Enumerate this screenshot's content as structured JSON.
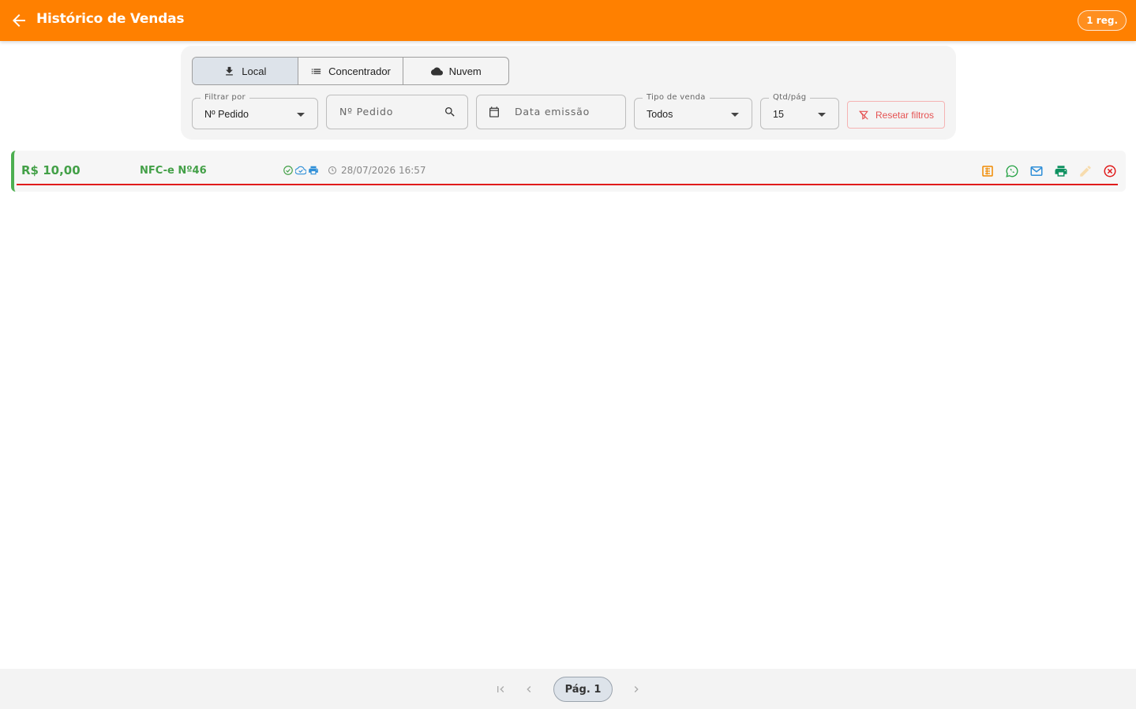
{
  "header": {
    "title": "Histórico de Vendas",
    "count_badge": "1 reg."
  },
  "source_tabs": [
    {
      "label": "Local",
      "icon": "download-icon",
      "active": true
    },
    {
      "label": "Concentrador",
      "icon": "list-icon",
      "active": false
    },
    {
      "label": "Nuvem",
      "icon": "cloud-icon",
      "active": false
    }
  ],
  "filters": {
    "filter_by": {
      "label": "Filtrar por",
      "value": "Nº Pedido"
    },
    "order_search": {
      "placeholder": "Nº Pedido"
    },
    "emission_date": {
      "placeholder": "Data emissão"
    },
    "sale_type": {
      "label": "Tipo de venda",
      "value": "Todos"
    },
    "per_page": {
      "label": "Qtd/pág",
      "value": "15"
    },
    "reset_label": "Resetar filtros"
  },
  "sales": [
    {
      "amount": "R$ 10,00",
      "document": "NFC-e Nº46",
      "datetime": "28/07/2026 16:57",
      "status_icons": [
        "check-circle-icon",
        "cloud-done-icon",
        "printer-icon"
      ],
      "actions": [
        "receipt-icon",
        "whatsapp-icon",
        "email-icon",
        "print-icon",
        "edit-icon",
        "cancel-icon"
      ]
    }
  ],
  "pagination": {
    "page_label": "Pág. 1"
  },
  "colors": {
    "brand": "#ff8000",
    "success": "#43a047",
    "danger": "#e01b1b"
  }
}
